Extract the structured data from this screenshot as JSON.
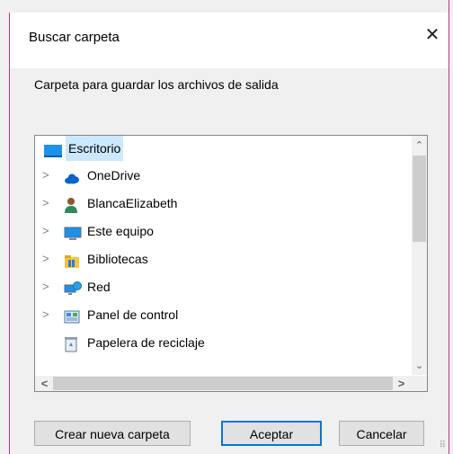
{
  "dialog": {
    "title": "Buscar carpeta",
    "close_glyph": "✕",
    "prompt": "Carpeta para guardar los archivos de salida",
    "tree": [
      {
        "label": "Escritorio",
        "icon": "desktop-icon",
        "selected": true,
        "expandable": false
      },
      {
        "label": "OneDrive",
        "icon": "onedrive-cloud-icon",
        "selected": false,
        "expandable": true
      },
      {
        "label": "BlancaElizabeth",
        "icon": "user-icon",
        "selected": false,
        "expandable": true
      },
      {
        "label": "Este equipo",
        "icon": "computer-icon",
        "selected": false,
        "expandable": true
      },
      {
        "label": "Bibliotecas",
        "icon": "libraries-folder-icon",
        "selected": false,
        "expandable": true
      },
      {
        "label": "Red",
        "icon": "network-icon",
        "selected": false,
        "expandable": true
      },
      {
        "label": "Panel de control",
        "icon": "control-panel-icon",
        "selected": false,
        "expandable": true
      },
      {
        "label": "Papelera de reciclaje",
        "icon": "recycle-bin-icon",
        "selected": false,
        "expandable": false
      }
    ],
    "buttons": {
      "new_folder": "Crear nueva carpeta",
      "ok": "Aceptar",
      "cancel": "Cancelar"
    }
  },
  "colors": {
    "accent": "#0078d7",
    "selection": "#cce8ff",
    "window_border": "#b33a7a"
  }
}
